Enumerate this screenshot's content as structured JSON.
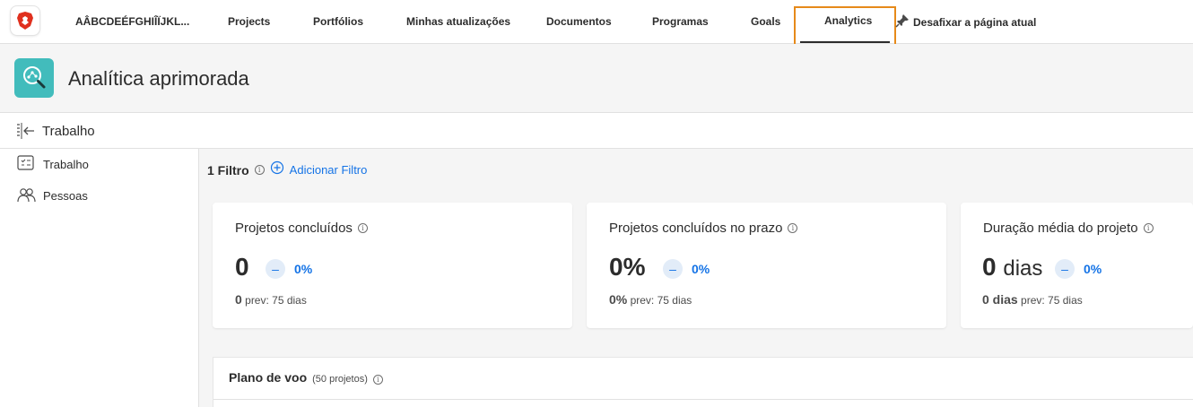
{
  "nav": {
    "workspace": "AÂBCDEÉFGHIÎÏJKL...",
    "items": [
      "Projects",
      "Portfólios",
      "Minhas atualizações",
      "Documentos",
      "Programas",
      "Goals",
      "Analytics"
    ],
    "active": "Analytics",
    "unpin_label": "Desafixar a página atual",
    "colors": {
      "highlight": "#e68a1a",
      "brand_logo": "#e0301e"
    }
  },
  "page": {
    "title": "Analítica aprimorada",
    "icon": "analytics-search-icon",
    "icon_color": "#42bcbc"
  },
  "section": {
    "title": "Trabalho"
  },
  "sidebar": {
    "items": [
      {
        "label": "Trabalho",
        "icon": "work-list-icon"
      },
      {
        "label": "Pessoas",
        "icon": "people-icon"
      }
    ]
  },
  "filter": {
    "count_label": "1 Filtro",
    "add_label": "Adicionar Filtro"
  },
  "cards": [
    {
      "title": "Projetos concluídos",
      "value": "0",
      "unit": "",
      "trend_symbol": "–",
      "trend_pct": "0%",
      "prev_value": "0",
      "prev_label": "prev: 75 dias"
    },
    {
      "title": "Projetos concluídos no prazo",
      "value": "0%",
      "unit": "",
      "trend_symbol": "–",
      "trend_pct": "0%",
      "prev_value": "0%",
      "prev_label": "prev: 75 dias"
    },
    {
      "title": "Duração média do projeto",
      "value": "0",
      "unit": "dias",
      "trend_symbol": "–",
      "trend_pct": "0%",
      "prev_value": "0 dias",
      "prev_label": "prev: 75 dias"
    }
  ],
  "plan": {
    "title": "Plano de voo",
    "count": "(50 projetos)"
  }
}
